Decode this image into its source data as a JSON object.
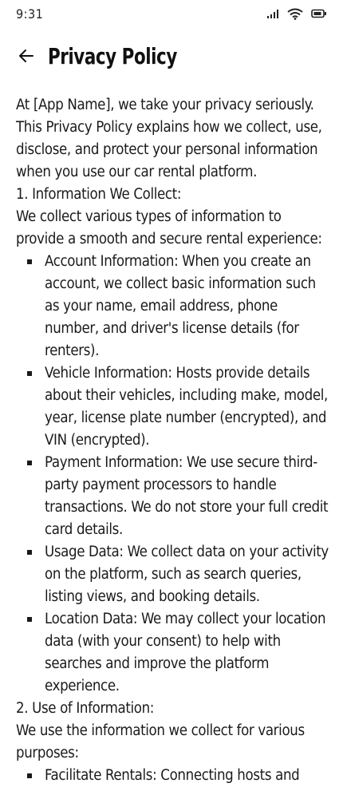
{
  "status_bar": {
    "time": "9:31",
    "icons": [
      "signal-icon",
      "wifi-icon",
      "battery-icon"
    ]
  },
  "header": {
    "back_icon": "arrow-left-icon",
    "title": "Privacy Policy"
  },
  "content": {
    "intro": "At [App Name], we take your privacy seriously. This Privacy Policy explains how we collect, use, disclose, and protect your personal information when you use our car rental platform.",
    "section1": {
      "heading": "1. Information We Collect:",
      "lead": "We collect various types of information to provide a smooth and secure rental experience:",
      "items": [
        "Account Information:  When you create an account, we collect basic information such as your name, email address, phone number, and driver's license details (for renters).",
        "Vehicle Information: Hosts provide details about their vehicles, including make, model, year, license plate number (encrypted), and VIN (encrypted).",
        "Payment Information: We use secure third-party payment processors to handle transactions. We do not store your full credit card details.",
        "Usage Data: We collect data on your activity on the platform, such as search queries, listing views, and booking details.",
        "Location Data:  We may collect your location data (with your consent) to help with searches and improve the platform experience."
      ]
    },
    "section2": {
      "heading": "2. Use of Information:",
      "lead": "We use the information we collect for various purposes:",
      "items": [
        "Facilitate Rentals:  Connecting hosts and"
      ]
    }
  }
}
